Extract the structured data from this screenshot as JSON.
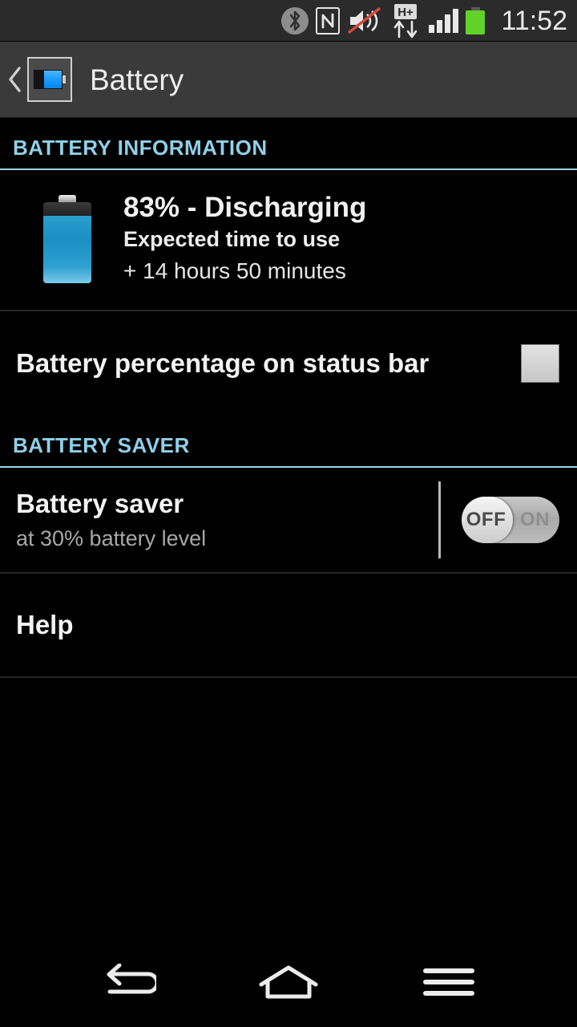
{
  "status_bar": {
    "time": "11:52",
    "icons": [
      {
        "name": "bluetooth-icon",
        "label": "Bluetooth"
      },
      {
        "name": "nfc-icon",
        "label": "NFC"
      },
      {
        "name": "sound-muted-icon",
        "label": "Sound off"
      },
      {
        "name": "hspa-plus-data-icon",
        "label": "H+"
      },
      {
        "name": "signal-bars-icon",
        "label": "Signal 4 bars"
      },
      {
        "name": "battery-status-icon",
        "label": "Battery"
      }
    ],
    "data_type_label": "H+",
    "signal_bars": 4,
    "battery_color": "#62d12a"
  },
  "action_bar": {
    "back_icon": "chevron-left-icon",
    "app_icon": "battery-icon",
    "title": "Battery"
  },
  "sections": {
    "battery_information": {
      "header": "BATTERY INFORMATION",
      "status": {
        "percent_label": "83% - Discharging",
        "expected_label": "Expected time to use",
        "time_remaining": "+ 14 hours 50 minutes",
        "battery_level_percent": 83,
        "fill_color": "#1b8fc4"
      },
      "percentage_pref": {
        "title": "Battery percentage on status bar",
        "checked": false
      }
    },
    "battery_saver": {
      "header": "BATTERY SAVER",
      "saver_pref": {
        "title": "Battery saver",
        "subtitle": "at  30% battery level",
        "toggle_off_label": "OFF",
        "toggle_on_label": "ON",
        "state": "OFF"
      },
      "help_pref": {
        "title": "Help"
      }
    }
  },
  "nav_bar": {
    "back_label": "Back",
    "home_label": "Home",
    "menu_label": "Menu"
  },
  "colors": {
    "accent": "#8fd0e8",
    "background": "#000000",
    "action_bar": "#3a3a3a",
    "status_bar": "#2b2b2b"
  }
}
